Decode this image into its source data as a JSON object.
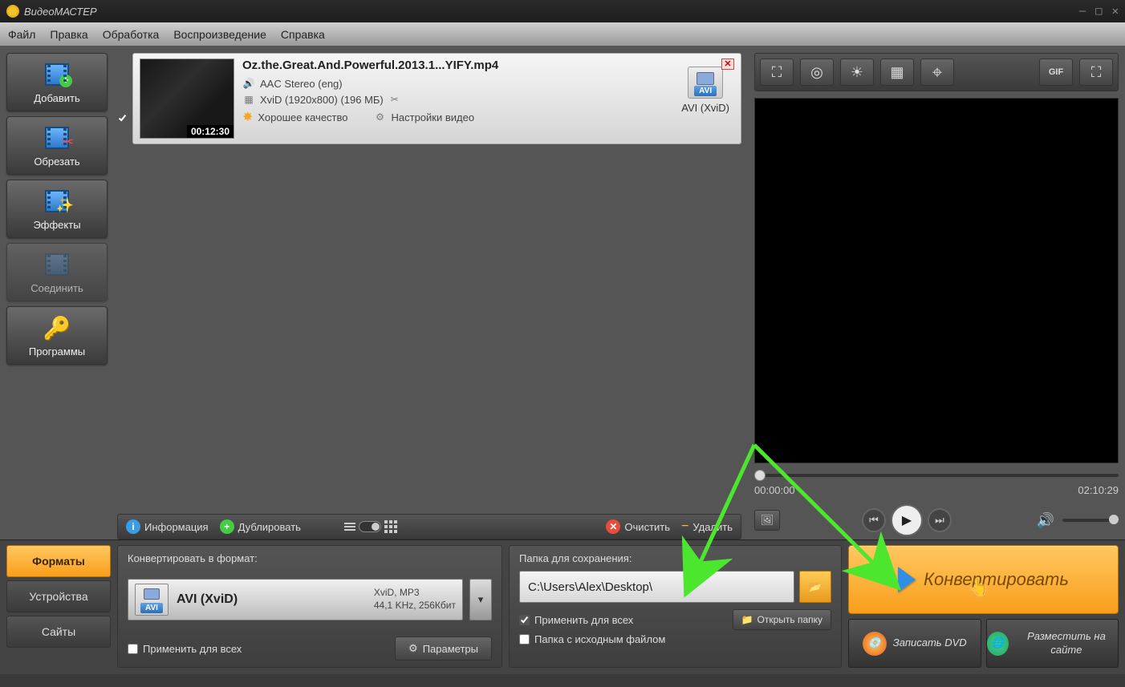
{
  "app": {
    "title": "ВидеоМАСТЕР"
  },
  "menu": [
    "Файл",
    "Правка",
    "Обработка",
    "Воспроизведение",
    "Справка"
  ],
  "sidebar": [
    {
      "label": "Добавить",
      "icon": "film-add"
    },
    {
      "label": "Обрезать",
      "icon": "film-cut"
    },
    {
      "label": "Эффекты",
      "icon": "film-fx"
    },
    {
      "label": "Соединить",
      "icon": "film-join",
      "disabled": true
    },
    {
      "label": "Программы",
      "icon": "key"
    }
  ],
  "file": {
    "title": "Oz.the.Great.And.Powerful.2013.1...YIFY.mp4",
    "audio": "AAC Stereo (eng)",
    "video": "XviD (1920x800) (196 МБ)",
    "quality_label": "Хорошее качество",
    "settings_label": "Настройки видео",
    "duration": "00:12:30",
    "format_badge": "AVI",
    "format_label": "AVI (XviD)"
  },
  "list_toolbar": {
    "info": "Информация",
    "dup": "Дублировать",
    "clear": "Очистить",
    "delete": "Удалить"
  },
  "preview": {
    "time_current": "00:00:00",
    "time_total": "02:10:29"
  },
  "bottom_tabs": [
    "Форматы",
    "Устройства",
    "Сайты"
  ],
  "format_panel": {
    "label": "Конвертировать в формат:",
    "name": "AVI (XviD)",
    "specs1": "XviD, MP3",
    "specs2": "44,1 KHz, 256Кбит",
    "badge": "AVI",
    "apply_all": "Применить для всех",
    "params": "Параметры"
  },
  "save_panel": {
    "label": "Папка для сохранения:",
    "path": "C:\\Users\\Alex\\Desktop\\",
    "apply_all": "Применить для всех",
    "same_folder": "Папка с исходным файлом",
    "open": "Открыть папку"
  },
  "actions": {
    "convert": "Конвертировать",
    "dvd": "Записать DVD",
    "publish": "Разместить на сайте"
  }
}
